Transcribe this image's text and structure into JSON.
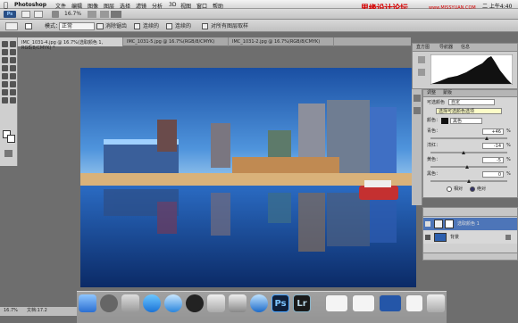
{
  "menubar": {
    "apple": "",
    "app": "Photoshop",
    "items": [
      "文件",
      "编辑",
      "图像",
      "图层",
      "选择",
      "滤镜",
      "分析",
      "3D",
      "视图",
      "窗口",
      "帮助"
    ],
    "watermark": "思缘设计论坛",
    "watermark_url": "www.MISSYUAN.COM",
    "clock": "二 上午4:40"
  },
  "appbar": {
    "zoom": "16.7%"
  },
  "optbar": {
    "mode_label": "模式：",
    "mode_value": "正常",
    "opacity_label": "不透明度：",
    "flow_label": "流量：",
    "option1": "消除锯齿",
    "option2": "连续的",
    "option3": "对所有图层取样"
  },
  "tabs": [
    {
      "label": "IMC_1031-4.jpg @ 16.7%(选取颜色 1, RGB/8/CMYK) *"
    },
    {
      "label": "IMC_1031-5.jpg @ 16.7%(RGB/8/CMYK)"
    },
    {
      "label": "IMC_1031-2.jpg @ 16.7%(RGB/8/CMYK)"
    }
  ],
  "doc_title": "IMC_1031-4.jpg @ 16.7%(选取颜色 1, RGB/8/CMYK) *",
  "histogram": {
    "tabs": [
      "直方图",
      "导航器",
      "信息"
    ]
  },
  "adjustments": {
    "tabs": [
      "调整",
      "蒙版"
    ],
    "preset_label": "可选颜色",
    "preset_value": "自定",
    "tooltip": "选择可选颜色选项",
    "colors_label": "颜色：",
    "colors_value": "黑色",
    "sliders": [
      {
        "label": "青色：",
        "value": "+46",
        "unit": "%",
        "level": 0.73
      },
      {
        "label": "洋红：",
        "value": "-14",
        "unit": "%",
        "level": 0.43
      },
      {
        "label": "黄色：",
        "value": "-5",
        "unit": "%",
        "level": 0.475
      },
      {
        "label": "黑色：",
        "value": "0",
        "unit": "%",
        "level": 0.5
      }
    ],
    "method_relative": "相对",
    "method_absolute": "绝对"
  },
  "layers": [
    {
      "name": "选取颜色 1"
    },
    {
      "name": "背景"
    }
  ],
  "status": {
    "zoom": "16.7%",
    "doc": "文档:17.2"
  },
  "dock": {
    "ps": "Ps",
    "lr": "Lr"
  }
}
